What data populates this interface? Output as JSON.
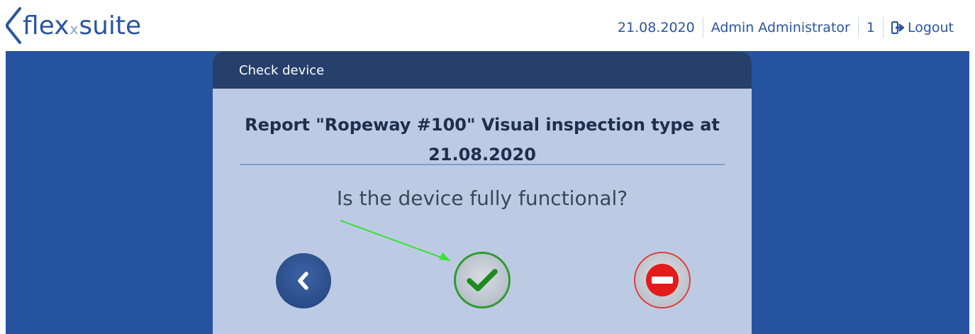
{
  "header": {
    "logo_icon": "flex-bracket-icon",
    "logo_main": "flex",
    "logo_x": "x",
    "logo_suite": "suite",
    "date": "21.08.2020",
    "user": "Admin Administrator",
    "count": "1",
    "logout_label": "Logout",
    "logout_icon": "sign-out-icon"
  },
  "card": {
    "header_title": "Check device",
    "report_title": "Report \"Ropeway #100\" Visual inspection type at 21.08.2020",
    "question": "Is the device fully functional?",
    "back_icon": "chevron-left-icon",
    "yes_icon": "checkmark-icon",
    "no_icon": "minus-circle-icon"
  },
  "colors": {
    "page_blue": "#2553a0",
    "card_bg": "#bccbe3",
    "card_header": "#263f6b",
    "yes_green": "#2f9a2f",
    "no_red": "#e23b3b",
    "annotation_arrow": "#3de03d"
  }
}
